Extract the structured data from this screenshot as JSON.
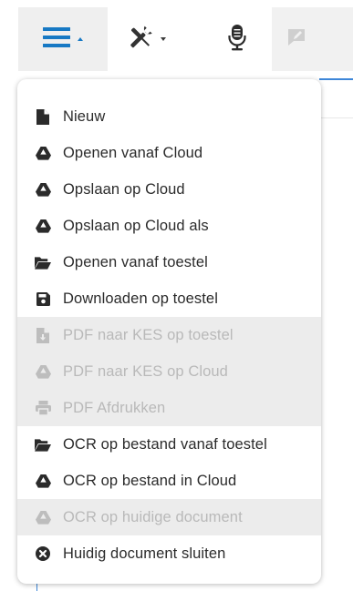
{
  "colors": {
    "accent": "#1779c4",
    "icon": "#2b2b2b",
    "disabled_text": "#b9b9b9",
    "disabled_bg": "#ececec"
  },
  "toolbar": {
    "buttons": [
      {
        "name": "menu",
        "icon": "hamburger-icon",
        "dropdown": true,
        "active": true
      },
      {
        "name": "tools",
        "icon": "tools-icon",
        "dropdown": true
      },
      {
        "name": "mic",
        "icon": "microphone-icon"
      },
      {
        "name": "note",
        "icon": "note-edit-icon"
      }
    ]
  },
  "menu": {
    "items": [
      {
        "label": "Nieuw",
        "icon": "file-icon",
        "enabled": true
      },
      {
        "label": "Openen vanaf Cloud",
        "icon": "google-drive-icon",
        "enabled": true
      },
      {
        "label": "Opslaan op Cloud",
        "icon": "google-drive-icon",
        "enabled": true
      },
      {
        "label": "Opslaan op Cloud als",
        "icon": "google-drive-icon",
        "enabled": true
      },
      {
        "label": "Openen vanaf toestel",
        "icon": "folder-open-icon",
        "enabled": true
      },
      {
        "label": "Downloaden op toestel",
        "icon": "save-icon",
        "enabled": true
      },
      {
        "label": "PDF naar KES op toestel",
        "icon": "file-download-icon",
        "enabled": false
      },
      {
        "label": "PDF naar KES op Cloud",
        "icon": "google-drive-icon",
        "enabled": false
      },
      {
        "label": "PDF Afdrukken",
        "icon": "print-icon",
        "enabled": false
      },
      {
        "label": "OCR op bestand vanaf toestel",
        "icon": "folder-open-icon",
        "enabled": true
      },
      {
        "label": "OCR op bestand in Cloud",
        "icon": "google-drive-icon",
        "enabled": true
      },
      {
        "label": "OCR op huidige document",
        "icon": "google-drive-icon",
        "enabled": false
      },
      {
        "label": "Huidig document sluiten",
        "icon": "close-circle-icon",
        "enabled": true
      }
    ]
  }
}
